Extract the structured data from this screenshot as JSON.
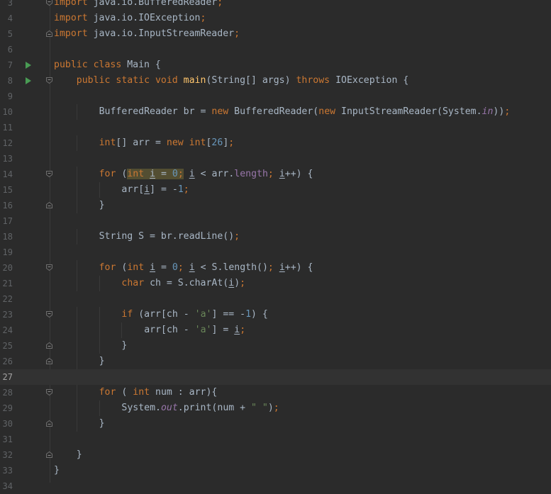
{
  "editor": {
    "lines": [
      {
        "n": "3",
        "run": false,
        "fold": "start",
        "indent": 0,
        "tokens": [
          [
            "kw",
            "import"
          ],
          [
            "",
            "&nbsp;java.io.BufferedReader"
          ],
          [
            "kw",
            ";"
          ]
        ]
      },
      {
        "n": "4",
        "run": false,
        "fold": "",
        "indent": 0,
        "tokens": [
          [
            "kw",
            "import"
          ],
          [
            "",
            "&nbsp;java.io.IOException"
          ],
          [
            "kw",
            ";"
          ]
        ]
      },
      {
        "n": "5",
        "run": false,
        "fold": "end",
        "indent": 0,
        "tokens": [
          [
            "kw",
            "import"
          ],
          [
            "",
            "&nbsp;java.io.InputStreamReader"
          ],
          [
            "kw",
            ";"
          ]
        ]
      },
      {
        "n": "6",
        "run": false,
        "fold": "",
        "indent": 0,
        "tokens": []
      },
      {
        "n": "7",
        "run": true,
        "fold": "",
        "indent": 0,
        "tokens": [
          [
            "kw",
            "public class"
          ],
          [
            "",
            "&nbsp;Main {"
          ]
        ]
      },
      {
        "n": "8",
        "run": true,
        "fold": "start",
        "indent": 1,
        "tokens": [
          [
            "kw",
            "public static void"
          ],
          [
            "",
            "&nbsp;"
          ],
          [
            "fn",
            "main"
          ],
          [
            "",
            "(String[] args) "
          ],
          [
            "kw",
            "throws"
          ],
          [
            "",
            "&nbsp;IOException {"
          ]
        ]
      },
      {
        "n": "9",
        "run": false,
        "fold": "",
        "indent": 0,
        "tokens": []
      },
      {
        "n": "10",
        "run": false,
        "fold": "",
        "indent": 2,
        "tokens": [
          [
            "",
            "BufferedReader br = "
          ],
          [
            "kw",
            "new"
          ],
          [
            "",
            "&nbsp;BufferedReader("
          ],
          [
            "kw",
            "new"
          ],
          [
            "",
            "&nbsp;InputStreamReader(System."
          ],
          [
            "sfld",
            "in"
          ],
          [
            "",
            "))"
          ],
          [
            "kw",
            ";"
          ]
        ]
      },
      {
        "n": "11",
        "run": false,
        "fold": "",
        "indent": 0,
        "tokens": []
      },
      {
        "n": "12",
        "run": false,
        "fold": "",
        "indent": 2,
        "tokens": [
          [
            "kw",
            "int"
          ],
          [
            "",
            "[] arr = "
          ],
          [
            "kw",
            "new int"
          ],
          [
            "",
            "["
          ],
          [
            "num",
            "26"
          ],
          [
            "",
            "]"
          ],
          [
            "kw",
            ";"
          ]
        ]
      },
      {
        "n": "13",
        "run": false,
        "fold": "",
        "indent": 0,
        "tokens": []
      },
      {
        "n": "14",
        "run": false,
        "fold": "start",
        "indent": 2,
        "tokens": [
          [
            "kw",
            "for"
          ],
          [
            "",
            "&nbsp;("
          ],
          [
            "hlkw",
            "int"
          ],
          [
            "hl",
            "&nbsp;"
          ],
          [
            "hlu",
            "i"
          ],
          [
            "hl",
            "&nbsp;= "
          ],
          [
            "hlnum",
            "0"
          ],
          [
            "hlkw",
            ";"
          ],
          [
            "",
            "&nbsp;"
          ],
          [
            "u",
            "i"
          ],
          [
            "",
            "&nbsp;&lt; arr."
          ],
          [
            "fld",
            "length"
          ],
          [
            "kw",
            ";"
          ],
          [
            "",
            "&nbsp;"
          ],
          [
            "u",
            "i"
          ],
          [
            "",
            "++) {"
          ]
        ]
      },
      {
        "n": "15",
        "run": false,
        "fold": "",
        "indent": 3,
        "tokens": [
          [
            "",
            "arr["
          ],
          [
            "u",
            "i"
          ],
          [
            "",
            "] = -"
          ],
          [
            "num",
            "1"
          ],
          [
            "kw",
            ";"
          ]
        ]
      },
      {
        "n": "16",
        "run": false,
        "fold": "end",
        "indent": 2,
        "tokens": [
          [
            "",
            "}"
          ]
        ]
      },
      {
        "n": "17",
        "run": false,
        "fold": "",
        "indent": 0,
        "tokens": []
      },
      {
        "n": "18",
        "run": false,
        "fold": "",
        "indent": 2,
        "tokens": [
          [
            "",
            "String S = br.readLine()"
          ],
          [
            "kw",
            ";"
          ]
        ]
      },
      {
        "n": "19",
        "run": false,
        "fold": "",
        "indent": 0,
        "tokens": []
      },
      {
        "n": "20",
        "run": false,
        "fold": "start",
        "indent": 2,
        "tokens": [
          [
            "kw",
            "for"
          ],
          [
            "",
            "&nbsp;("
          ],
          [
            "kw",
            "int"
          ],
          [
            "",
            "&nbsp;"
          ],
          [
            "u",
            "i"
          ],
          [
            "",
            "&nbsp;= "
          ],
          [
            "num",
            "0"
          ],
          [
            "kw",
            ";"
          ],
          [
            "",
            "&nbsp;"
          ],
          [
            "u",
            "i"
          ],
          [
            "",
            "&nbsp;&lt; S.length()"
          ],
          [
            "kw",
            ";"
          ],
          [
            "",
            "&nbsp;"
          ],
          [
            "u",
            "i"
          ],
          [
            "",
            "++) {"
          ]
        ]
      },
      {
        "n": "21",
        "run": false,
        "fold": "",
        "indent": 3,
        "tokens": [
          [
            "kw",
            "char"
          ],
          [
            "",
            "&nbsp;ch = S.charAt("
          ],
          [
            "u",
            "i"
          ],
          [
            "",
            ")"
          ],
          [
            "kw",
            ";"
          ]
        ]
      },
      {
        "n": "22",
        "run": false,
        "fold": "",
        "indent": 0,
        "tokens": []
      },
      {
        "n": "23",
        "run": false,
        "fold": "start",
        "indent": 3,
        "tokens": [
          [
            "kw",
            "if"
          ],
          [
            "",
            "&nbsp;(arr[ch - "
          ],
          [
            "str",
            "'a'"
          ],
          [
            "",
            "] == -"
          ],
          [
            "num",
            "1"
          ],
          [
            "",
            ") {"
          ]
        ]
      },
      {
        "n": "24",
        "run": false,
        "fold": "",
        "indent": 4,
        "tokens": [
          [
            "",
            "arr[ch - "
          ],
          [
            "str",
            "'a'"
          ],
          [
            "",
            "] = "
          ],
          [
            "u",
            "i"
          ],
          [
            "kw",
            ";"
          ]
        ]
      },
      {
        "n": "25",
        "run": false,
        "fold": "end",
        "indent": 3,
        "tokens": [
          [
            "",
            "}"
          ]
        ]
      },
      {
        "n": "26",
        "run": false,
        "fold": "end",
        "indent": 2,
        "tokens": [
          [
            "",
            "}"
          ]
        ]
      },
      {
        "n": "27",
        "run": false,
        "fold": "",
        "indent": 0,
        "current": true,
        "tokens": []
      },
      {
        "n": "28",
        "run": false,
        "fold": "start",
        "indent": 2,
        "tokens": [
          [
            "kw",
            "for"
          ],
          [
            "",
            "&nbsp;( "
          ],
          [
            "kw",
            "int"
          ],
          [
            "",
            "&nbsp;num : arr){"
          ]
        ]
      },
      {
        "n": "29",
        "run": false,
        "fold": "",
        "indent": 3,
        "tokens": [
          [
            "",
            "System."
          ],
          [
            "sfld",
            "out"
          ],
          [
            "",
            ".print(num + "
          ],
          [
            "str",
            "\" \""
          ],
          [
            "",
            ")"
          ],
          [
            "kw",
            ";"
          ]
        ]
      },
      {
        "n": "30",
        "run": false,
        "fold": "end",
        "indent": 2,
        "tokens": [
          [
            "",
            "}"
          ]
        ]
      },
      {
        "n": "31",
        "run": false,
        "fold": "",
        "indent": 0,
        "tokens": []
      },
      {
        "n": "32",
        "run": false,
        "fold": "end",
        "indent": 1,
        "tokens": [
          [
            "",
            "}"
          ]
        ]
      },
      {
        "n": "33",
        "run": false,
        "fold": "",
        "indent": 0,
        "tokens": [
          [
            "",
            "}"
          ]
        ]
      },
      {
        "n": "34",
        "run": false,
        "fold": "",
        "indent": 0,
        "tokens": []
      }
    ]
  }
}
